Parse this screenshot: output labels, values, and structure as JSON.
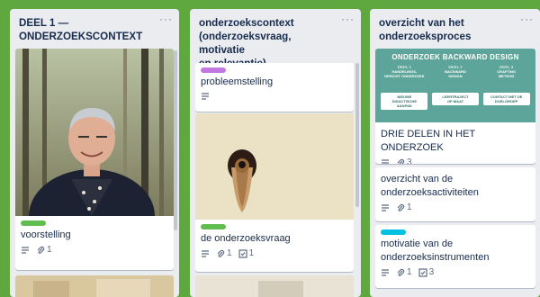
{
  "colors": {
    "board": "#5fa83f",
    "list": "#ebecf0",
    "label_green": "#61bd4f",
    "label_purple": "#c377e0",
    "label_sky": "#00c2e0",
    "infographic_bg": "#5da59a"
  },
  "lists": [
    {
      "title": "DEEL 1 —\nONDERZOEKSCONTEXT",
      "menu": "···",
      "cards": [
        {
          "title": "voorstelling",
          "label": "green",
          "cover": "photo of a smiling man in a forest",
          "badges": {
            "description": true,
            "attachments": "1"
          }
        },
        {
          "title": "",
          "cover": "partial image (cut off)"
        }
      ]
    },
    {
      "title": "onderzoekscontext\n(onderzoeksvraag, motivatie\nen relevantie)",
      "menu": "···",
      "cards": [
        {
          "title": "probleemstelling",
          "label": "purple",
          "badges": {
            "description": true
          }
        },
        {
          "title": "de onderzoeksvraag",
          "label": "green",
          "cover": "keyhole image",
          "badges": {
            "description": true,
            "attachments": "1",
            "checklist": "1"
          }
        }
      ]
    },
    {
      "title": "overzicht van het\nonderzoeksproces",
      "menu": "···",
      "cards": [
        {
          "title": "DRIE DELEN IN HET ONDERZOEK",
          "cover": "infographic",
          "infographic": {
            "heading": "ONDERZOEK BACKWARD DESIGN",
            "phases": [
              {
                "step": "DEEL 1",
                "name": "HANDELINGS-\nGERICHT ONDERZOEK",
                "box": "NIEUWE\nDIDACTISCHE\nAANPAK"
              },
              {
                "step": "DEEL 2",
                "name": "BACKWARD\nDESIGN",
                "box": "LEERTRAJECT\nOP MAAT"
              },
              {
                "step": "DEEL 3",
                "name": "CRAFTING\nMETHOD",
                "box": "CONTACT MET DE\nDOELGROEP"
              }
            ]
          },
          "badges": {
            "description": true,
            "attachments": "3"
          }
        },
        {
          "title": "overzicht van de onderzoeksactiviteiten",
          "badges": {
            "description": true,
            "attachments": "1"
          }
        },
        {
          "title": "motivatie van de onderzoeksinstrumenten",
          "label": "sky",
          "badges": {
            "description": true,
            "attachments": "1",
            "checklist": "3"
          }
        }
      ]
    }
  ]
}
